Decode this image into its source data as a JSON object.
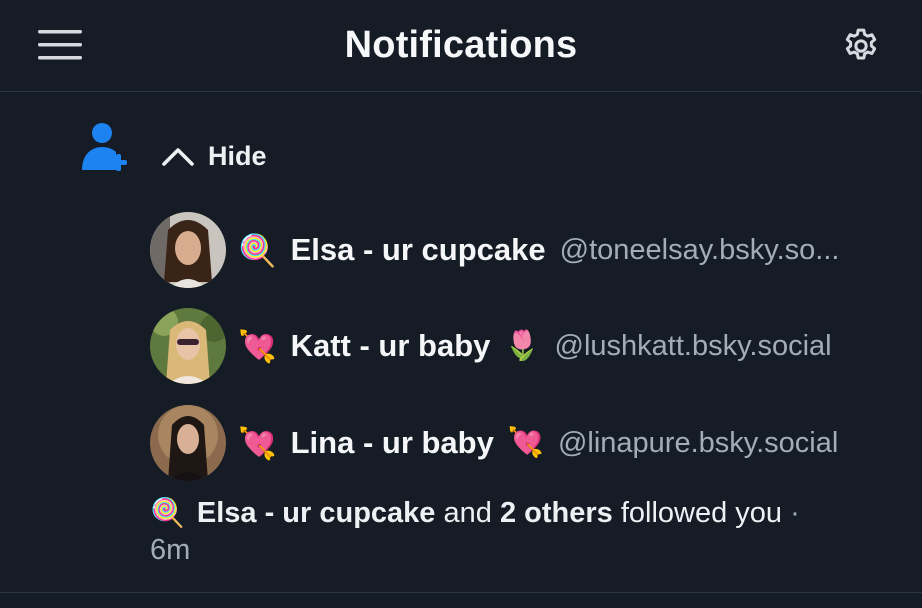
{
  "header": {
    "title": "Notifications"
  },
  "follow_group": {
    "toggle_label": "Hide",
    "followers": [
      {
        "emoji": "🍭",
        "display_name": "Elsa - ur cupcake",
        "name_emoji": "",
        "handle": "@toneelsay.bsky.so..."
      },
      {
        "emoji": "💘",
        "display_name": "Katt - ur baby",
        "name_emoji": "🌷",
        "handle": "@lushkatt.bsky.social"
      },
      {
        "emoji": "💘",
        "display_name": "Lina - ur baby",
        "name_emoji": "💘",
        "handle": "@linapure.bsky.social"
      }
    ],
    "summary": {
      "emoji": "🍭",
      "name": "Elsa - ur cupcake",
      "and": "and",
      "others": "2 others",
      "action": "followed you",
      "separator": "·",
      "time": "6m"
    }
  },
  "colors": {
    "background": "#151c26",
    "accent": "#1d83f0",
    "muted_text": "#a4acb8"
  }
}
